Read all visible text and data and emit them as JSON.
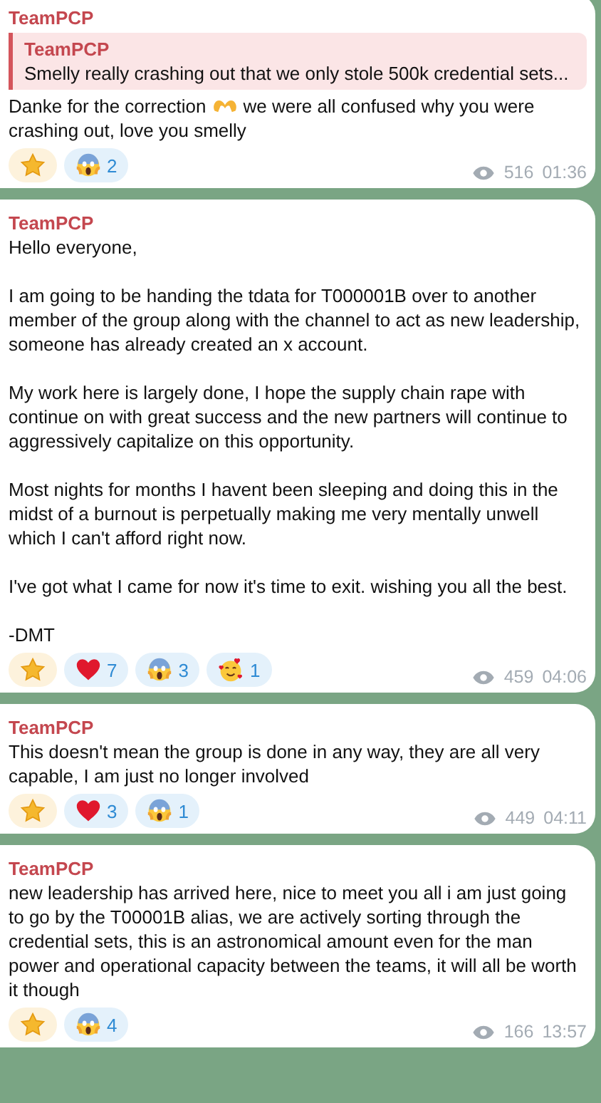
{
  "messages": [
    {
      "author": "TeamPCP",
      "reply": {
        "author": "TeamPCP",
        "text": "Smelly really crashing out that we only stole 500k credential sets..."
      },
      "paragraphs": [
        [
          {
            "kind": "text",
            "text": "Danke for the correction"
          },
          {
            "kind": "hands_icon"
          },
          {
            "kind": "text",
            "text": "we were all confused why you were"
          },
          {
            "kind": "text",
            "text": "crashing out, love you smelly"
          }
        ]
      ],
      "reactions": [
        {
          "kind": "star"
        },
        {
          "kind": "scream",
          "count": "2"
        }
      ],
      "views": "516",
      "time": "01:36"
    },
    {
      "author": "TeamPCP",
      "paragraphs": [
        [
          {
            "kind": "text",
            "text": "Hello everyone,"
          }
        ],
        [
          {
            "kind": "text",
            "text": "I am going to be handing the tdata for T000001B over to another member of the group along with the channel to act as new leadership, someone has already created an x account."
          }
        ],
        [
          {
            "kind": "text",
            "text": "My work here is largely done, I hope the supply chain rape with continue on with great success and the new partners will continue to aggressively capitalize on this opportunity."
          }
        ],
        [
          {
            "kind": "text",
            "text": "Most nights for months I havent been sleeping and doing this in the midst of a burnout is perpetually making me very mentally unwell which I can't afford right now."
          }
        ],
        [
          {
            "kind": "text",
            "text": "I've got what I came for now it's time to exit. wishing you all the best."
          }
        ],
        [
          {
            "kind": "text",
            "text": "-DMT"
          }
        ]
      ],
      "reactions": [
        {
          "kind": "star"
        },
        {
          "kind": "heart",
          "count": "7"
        },
        {
          "kind": "scream",
          "count": "3"
        },
        {
          "kind": "hearts_face",
          "count": "1"
        }
      ],
      "views": "459",
      "time": "04:06"
    },
    {
      "author": "TeamPCP",
      "paragraphs": [
        [
          {
            "kind": "text",
            "text": "This doesn't mean the group is done in any way, they are all very capable, I am just no longer involved"
          }
        ]
      ],
      "reactions": [
        {
          "kind": "star"
        },
        {
          "kind": "heart",
          "count": "3"
        },
        {
          "kind": "scream",
          "count": "1"
        }
      ],
      "views": "449",
      "time": "04:11"
    },
    {
      "author": "TeamPCP",
      "paragraphs": [
        [
          {
            "kind": "text",
            "text": "new leadership has arrived here, nice to meet you all i am just going to go by the T00001B alias, we are actively sorting through the credential sets, this is an astronomical amount even for the man power and operational capacity between the teams, it will all be worth it though"
          }
        ]
      ],
      "reactions": [
        {
          "kind": "star"
        },
        {
          "kind": "scream",
          "count": "4"
        }
      ],
      "views": "166",
      "time": "13:57"
    }
  ]
}
